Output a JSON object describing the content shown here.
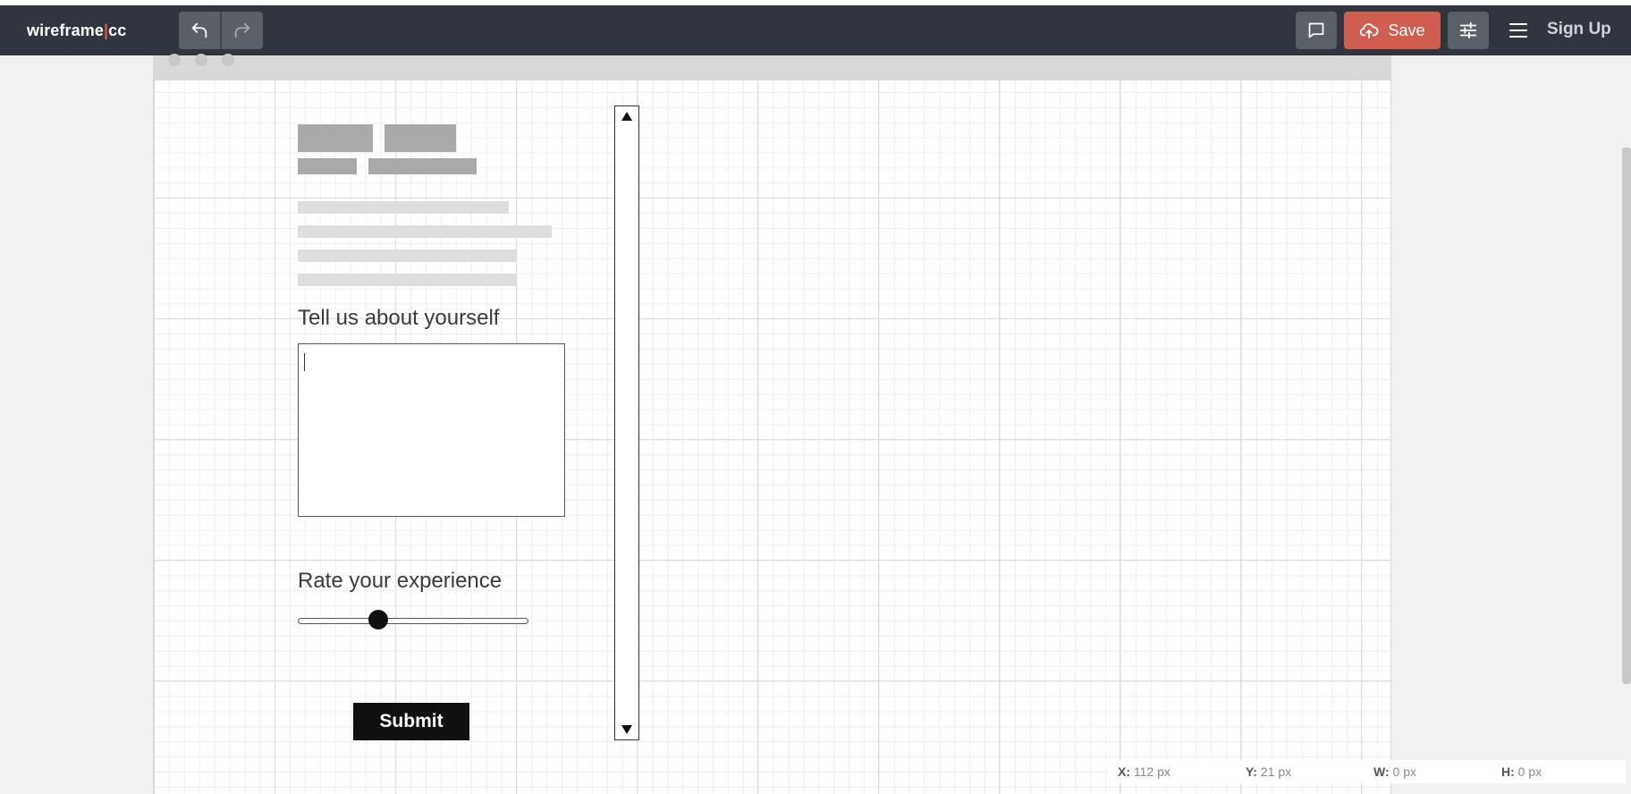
{
  "app": {
    "logo_left": "wireframe",
    "logo_sep": "|",
    "logo_right": "cc"
  },
  "header": {
    "undo_icon": "undo-icon",
    "redo_icon": "redo-icon",
    "comment_icon": "comment-icon",
    "save_icon": "cloud-upload-icon",
    "save_label": "Save",
    "settings_icon": "sliders-icon",
    "menu_icon": "hamburger-icon",
    "signup_label": "Sign Up",
    "save_color": "#cf5e4f",
    "bg_color": "#303540"
  },
  "wireframe": {
    "about_label": "Tell us about yourself",
    "rate_label": "Rate your experience",
    "submit_label": "Submit",
    "slider_value": 0.35
  },
  "status": {
    "x_key": "X:",
    "x_val": "112 px",
    "y_key": "Y:",
    "y_val": "21 px",
    "w_key": "W:",
    "w_val": "0 px",
    "h_key": "H:",
    "h_val": "0 px"
  }
}
